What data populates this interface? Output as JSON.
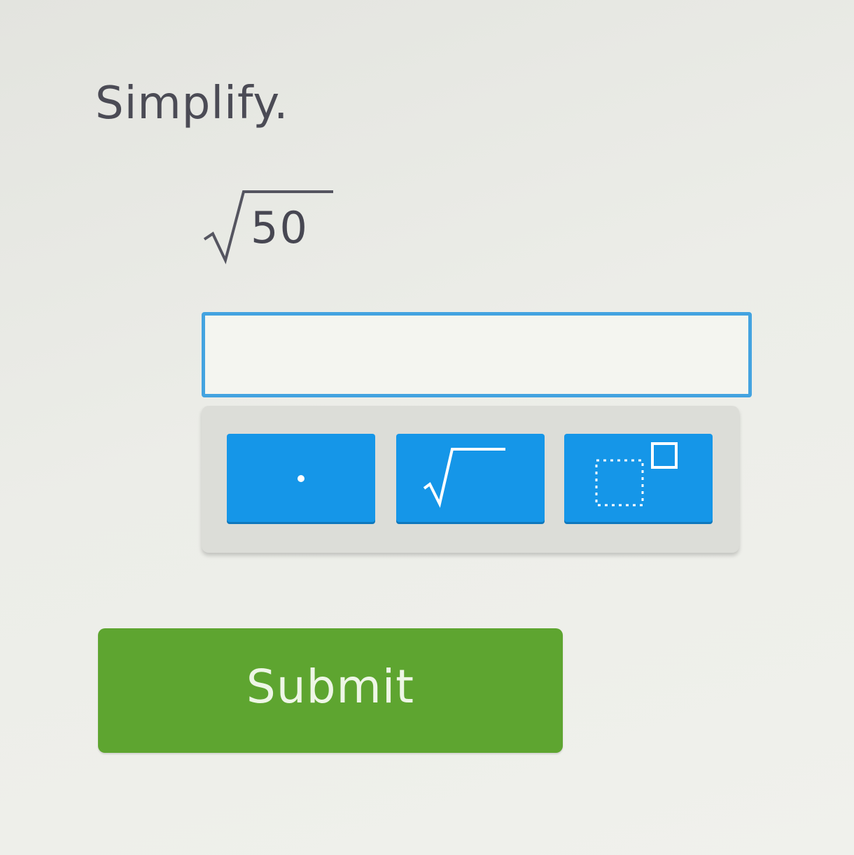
{
  "question": {
    "instruction": "Simplify.",
    "radicand": "50"
  },
  "answer": {
    "value": "",
    "placeholder": ""
  },
  "keypad": {
    "keys": [
      {
        "icon": "dot-icon"
      },
      {
        "icon": "square-root-icon"
      },
      {
        "icon": "exponent-icon"
      }
    ]
  },
  "submit": {
    "label": "Submit"
  },
  "colors": {
    "key_blue": "#1596e8",
    "input_border": "#43a3e0",
    "submit_green": "#5ea530",
    "text_gray": "#4b4b55"
  }
}
